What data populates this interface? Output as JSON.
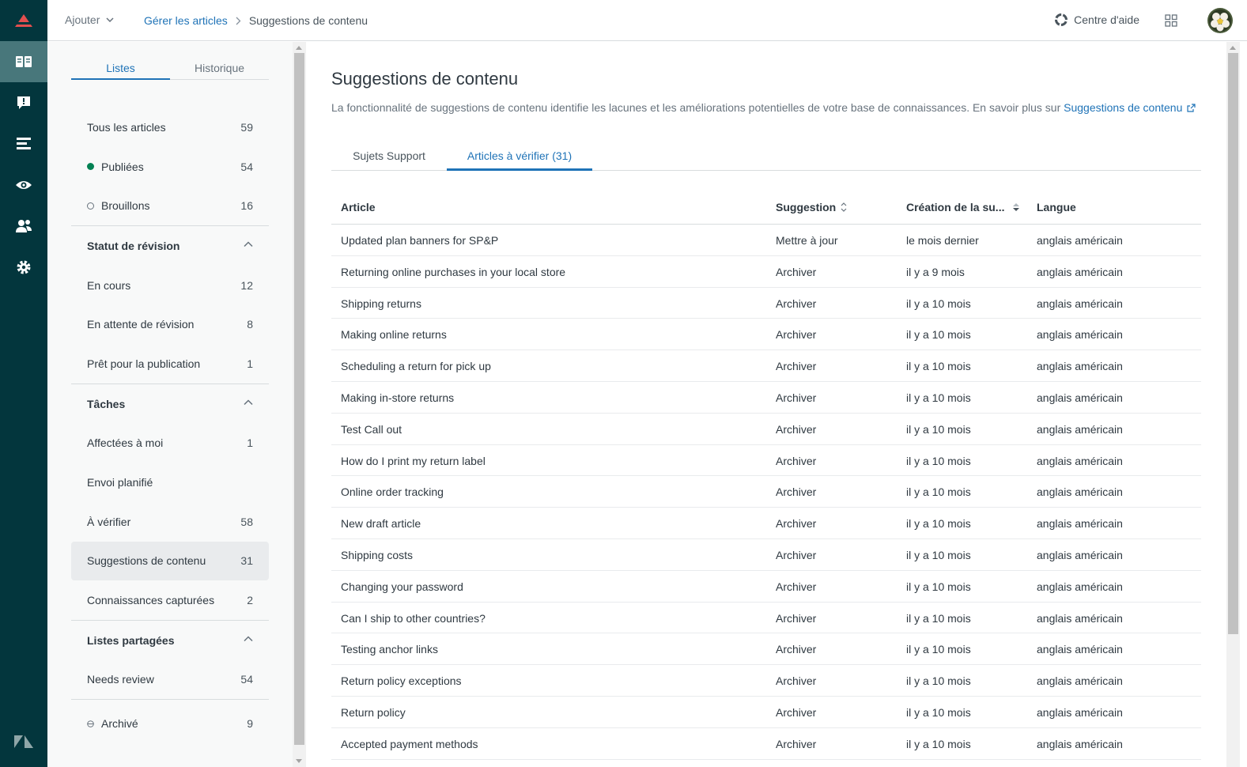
{
  "header": {
    "add_label": "Ajouter",
    "breadcrumb_link": "Gérer les articles",
    "breadcrumb_current": "Suggestions de contenu",
    "help_label": "Centre d'aide"
  },
  "sidebar": {
    "tabs": [
      "Listes",
      "Historique"
    ],
    "items": [
      {
        "label": "Tous les articles",
        "count": "59"
      },
      {
        "label": "Publiées",
        "count": "54"
      },
      {
        "label": "Brouillons",
        "count": "16"
      }
    ],
    "review_section": "Statut de révision",
    "review_items": [
      {
        "label": "En cours",
        "count": "12"
      },
      {
        "label": "En attente de révision",
        "count": "8"
      },
      {
        "label": "Prêt pour la publication",
        "count": "1"
      }
    ],
    "tasks_section": "Tâches",
    "task_items": [
      {
        "label": "Affectées à moi",
        "count": "1"
      },
      {
        "label": "Envoi planifié",
        "count": ""
      },
      {
        "label": "À vérifier",
        "count": "58"
      },
      {
        "label": "Suggestions de contenu",
        "count": "31"
      },
      {
        "label": "Connaissances capturées",
        "count": "2"
      }
    ],
    "shared_section": "Listes partagées",
    "shared_items": [
      {
        "label": "Needs review",
        "count": "54"
      }
    ],
    "archived": {
      "label": "Archivé",
      "count": "9"
    }
  },
  "main": {
    "title": "Suggestions de contenu",
    "description": "La fonctionnalité de suggestions de contenu identifie les lacunes et les améliorations potentielles de votre base de connaissances. En savoir plus sur",
    "description_link": "Suggestions de contenu",
    "tabs": [
      "Sujets Support",
      "Articles à vérifier (31)"
    ],
    "columns": [
      "Article",
      "Suggestion",
      "Création de la su...",
      "Langue"
    ],
    "rows": [
      [
        "Updated plan banners for SP&P",
        "Mettre à jour",
        "le mois dernier",
        "anglais américain"
      ],
      [
        "Returning online purchases in your local store",
        "Archiver",
        "il y a 9 mois",
        "anglais américain"
      ],
      [
        "Shipping returns",
        "Archiver",
        "il y a 10 mois",
        "anglais américain"
      ],
      [
        "Making online returns",
        "Archiver",
        "il y a 10 mois",
        "anglais américain"
      ],
      [
        "Scheduling a return for pick up",
        "Archiver",
        "il y a 10 mois",
        "anglais américain"
      ],
      [
        "Making in-store returns",
        "Archiver",
        "il y a 10 mois",
        "anglais américain"
      ],
      [
        "Test Call out",
        "Archiver",
        "il y a 10 mois",
        "anglais américain"
      ],
      [
        "How do I print my return label",
        "Archiver",
        "il y a 10 mois",
        "anglais américain"
      ],
      [
        "Online order tracking",
        "Archiver",
        "il y a 10 mois",
        "anglais américain"
      ],
      [
        "New draft article",
        "Archiver",
        "il y a 10 mois",
        "anglais américain"
      ],
      [
        "Shipping costs",
        "Archiver",
        "il y a 10 mois",
        "anglais américain"
      ],
      [
        "Changing your password",
        "Archiver",
        "il y a 10 mois",
        "anglais américain"
      ],
      [
        "Can I ship to other countries?",
        "Archiver",
        "il y a 10 mois",
        "anglais américain"
      ],
      [
        "Testing anchor links",
        "Archiver",
        "il y a 10 mois",
        "anglais américain"
      ],
      [
        "Return policy exceptions",
        "Archiver",
        "il y a 10 mois",
        "anglais américain"
      ],
      [
        "Return policy",
        "Archiver",
        "il y a 10 mois",
        "anglais américain"
      ],
      [
        "Accepted payment methods",
        "Archiver",
        "il y a 10 mois",
        "anglais américain"
      ]
    ]
  },
  "colors": {
    "rail_bg": "#03363d",
    "rail_active": "#48777b",
    "accent": "#1f73b7",
    "logo_red": "#e34f4f",
    "published_green": "#038153"
  }
}
